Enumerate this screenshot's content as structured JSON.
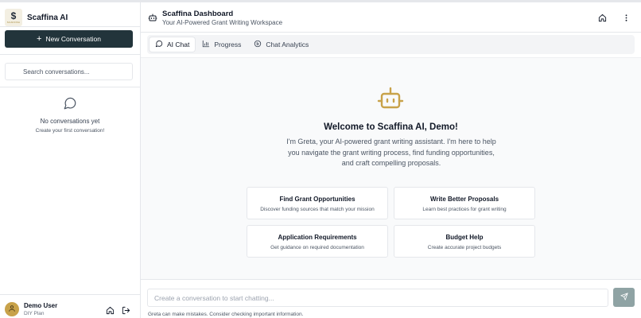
{
  "sidebar": {
    "brand_name": "Scaffina AI",
    "logo_symbol": "$",
    "logo_caption": "SCAFFINA",
    "new_conversation_label": "New Conversation",
    "search_placeholder": "Search conversations...",
    "empty_title": "No conversations yet",
    "empty_subtitle": "Create your first conversation!",
    "user": {
      "name": "Demo User",
      "plan": "DIY Plan"
    },
    "icons": [
      "chat-bubble-icon",
      "user-icon",
      "home-icon",
      "logout-icon"
    ]
  },
  "header": {
    "title": "Scaffina Dashboard",
    "subtitle": "Your AI-Powered Grant Writing Workspace",
    "icons": [
      "robot-icon",
      "home-icon",
      "more-vertical-icon"
    ]
  },
  "tabs": [
    {
      "label": "AI Chat",
      "icon": "chat-bubble-icon",
      "active": true
    },
    {
      "label": "Progress",
      "icon": "bar-chart-icon",
      "active": false
    },
    {
      "label": "Chat Analytics",
      "icon": "analytics-icon",
      "active": false
    }
  ],
  "main": {
    "welcome_title": "Welcome to Scaffina AI, Demo!",
    "intro": "I'm Greta, your AI-powered grant writing assistant. I'm here to help you navigate the grant writing process, find funding opportunities, and craft compelling proposals.",
    "cards": [
      {
        "title": "Find Grant Opportunities",
        "description": "Discover funding sources that match your mission"
      },
      {
        "title": "Write Better Proposals",
        "description": "Learn best practices for grant writing"
      },
      {
        "title": "Application Requirements",
        "description": "Get guidance on required documentation"
      },
      {
        "title": "Budget Help",
        "description": "Create accurate project budgets"
      }
    ]
  },
  "chat": {
    "input_placeholder": "Create a conversation to start chatting...",
    "disclaimer": "Greta can make mistakes. Consider checking important information."
  },
  "colors": {
    "primary_dark": "#22343b",
    "accent_gold": "#c8a24a",
    "send_disabled": "#8fa3a4"
  }
}
